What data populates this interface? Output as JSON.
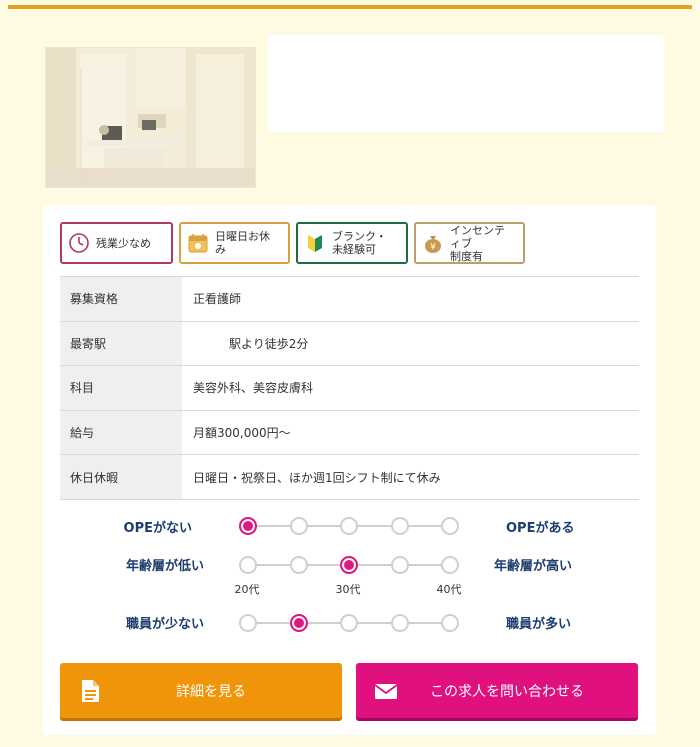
{
  "tags": [
    {
      "icon": "clock-icon",
      "lines": [
        "残業少なめ"
      ],
      "color": "#b23a5b"
    },
    {
      "icon": "calendar-icon",
      "lines": [
        "日曜日お休み"
      ],
      "color": "#d8a043"
    },
    {
      "icon": "beginner-mark-icon",
      "lines": [
        "ブランク・",
        "未経験可"
      ],
      "color": "#1f6b3f"
    },
    {
      "icon": "money-bag-icon",
      "lines": [
        "インセンティブ",
        "制度有"
      ],
      "color": "#b9a06a"
    }
  ],
  "info": {
    "qualification": {
      "label": "募集資格",
      "value": "正看護師"
    },
    "station": {
      "label": "最寄駅",
      "value": "駅より徒歩2分"
    },
    "department": {
      "label": "科目",
      "value": "美容外科、美容皮膚科"
    },
    "salary": {
      "label": "給与",
      "value": "月額300,000円～"
    },
    "holidays": {
      "label": "休日休暇",
      "value": "日曜日・祝祭日、ほか週1回シフト制にて休み"
    }
  },
  "scales": [
    {
      "left": "OPEがない",
      "right": "OPEがある",
      "selected": 1,
      "steps": 5
    },
    {
      "left": "年齢層が低い",
      "right": "年齢層が高い",
      "selected": 3,
      "steps": 5,
      "ages": [
        "20代",
        "30代",
        "40代"
      ]
    },
    {
      "left": "職員が少ない",
      "right": "職員が多い",
      "selected": 2,
      "steps": 5
    }
  ],
  "buttons": {
    "detail": "詳細を見る",
    "contact": "この求人を問い合わせる"
  },
  "colors": {
    "accent_orange": "#f0950a",
    "accent_pink": "#e0107f",
    "selected_dot": "#e0177f",
    "scale_text": "#1d3d6e"
  }
}
